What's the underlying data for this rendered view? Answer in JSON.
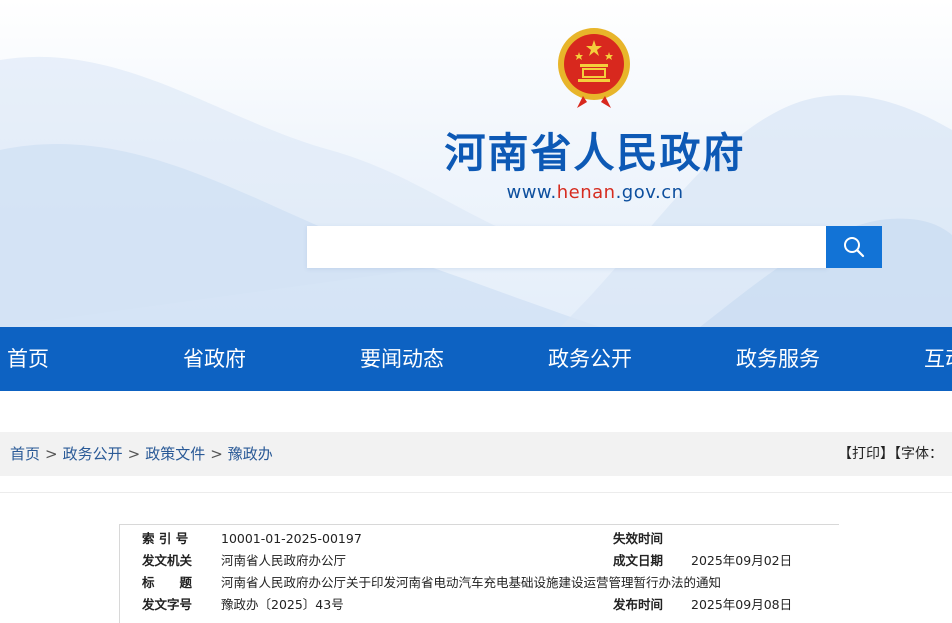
{
  "header": {
    "site_title": "河南省人民政府",
    "url_prefix": "www.",
    "url_highlight": "henan",
    "url_suffix": ".gov.cn",
    "search": {
      "value": "",
      "placeholder": ""
    },
    "search_icon": "search-icon"
  },
  "nav": {
    "items": [
      {
        "label": "首页"
      },
      {
        "label": "省政府"
      },
      {
        "label": "要闻动态"
      },
      {
        "label": "政务公开"
      },
      {
        "label": "政务服务"
      },
      {
        "label": "互动"
      }
    ]
  },
  "breadcrumb": {
    "items": [
      "首页",
      "政务公开",
      "政策文件",
      "豫政办"
    ],
    "separator": ">"
  },
  "tools": {
    "print": "【打印】",
    "font": "【字体："
  },
  "info": {
    "rows": [
      {
        "l1": "索 引 号",
        "v1": "10001-01-2025-00197",
        "l2": "失效时间",
        "v2": ""
      },
      {
        "l1": "发文机关",
        "v1": "河南省人民政府办公厅",
        "l2": "成文日期",
        "v2": "2025年09月02日"
      },
      {
        "l1": "标　　题",
        "v1": "河南省人民政府办公厅关于印发河南省电动汽车充电基础设施建设运营管理暂行办法的通知",
        "l2": "",
        "v2": ""
      },
      {
        "l1": "发文字号",
        "v1": "豫政办〔2025〕43号",
        "l2": "发布时间",
        "v2": "2025年09月08日"
      }
    ]
  },
  "colors": {
    "brand_blue": "#0d62c2",
    "title_blue": "#0d59b5",
    "url_red": "#d62c20",
    "search_button": "#1273d6"
  }
}
